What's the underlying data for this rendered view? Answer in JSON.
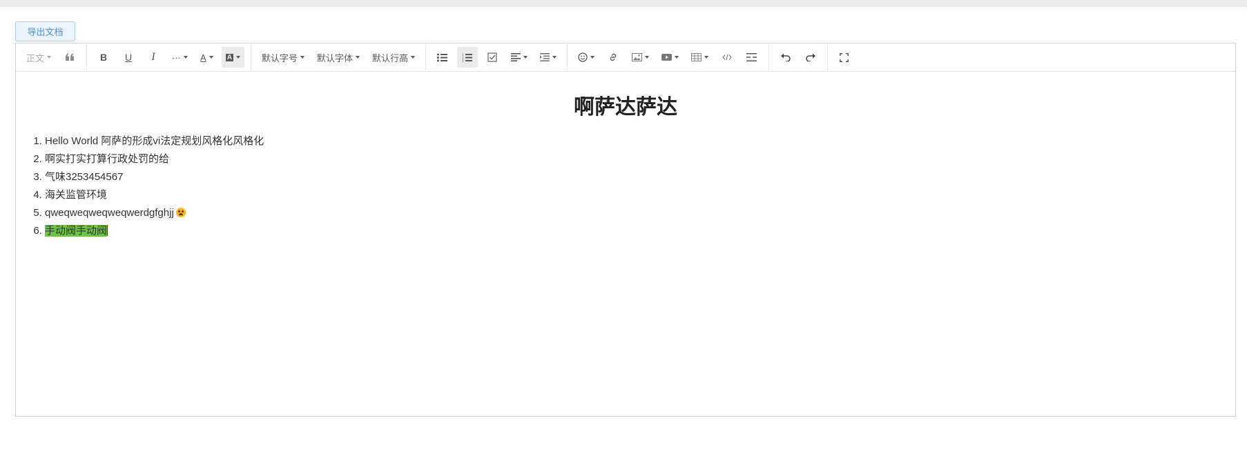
{
  "export_button": {
    "label": "导出文档"
  },
  "toolbar": {
    "paragraph_label": "正文",
    "font_size_label": "默认字号",
    "font_family_label": "默认字体",
    "line_height_label": "默认行高",
    "more_label": "···",
    "font_color_label": "A",
    "bg_color_label": "A",
    "icons": [
      "quote-icon",
      "bold-icon",
      "underline-icon",
      "italic-icon",
      "more-icon",
      "font-color-icon",
      "background-color-icon",
      "bulleted-list-icon",
      "numbered-list-icon",
      "todo-icon",
      "align-icon",
      "indent-icon",
      "emoji-icon",
      "link-icon",
      "image-icon",
      "video-icon",
      "table-icon",
      "code-icon",
      "divider-icon",
      "undo-icon",
      "redo-icon",
      "fullscreen-icon"
    ]
  },
  "document": {
    "title": "啊萨达萨达",
    "items": [
      "Hello World 阿萨的形成vi法定规划风格化风格化",
      "啊实打实打算行政处罚的给",
      "气味3253454567",
      "海关监管环境",
      "qweqweqweqweqwerdgfghjj",
      "手动阀手动阀"
    ]
  },
  "colors": {
    "highlight": "#6cc644",
    "accent": "#4a90e2"
  }
}
